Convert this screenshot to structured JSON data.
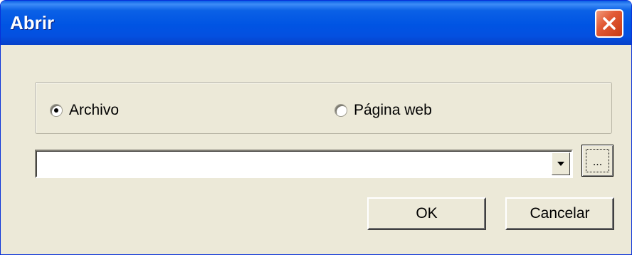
{
  "window": {
    "title": "Abrir",
    "title_bar_color": "#0054e3",
    "close_icon": "close-icon"
  },
  "source_group": {
    "options": [
      {
        "label": "Archivo",
        "checked": true
      },
      {
        "label": "Página web",
        "checked": false
      }
    ]
  },
  "address": {
    "value": "",
    "dropdown_icon": "chevron-down-icon"
  },
  "browse": {
    "label": "..."
  },
  "buttons": {
    "ok_label": "OK",
    "cancel_label": "Cancelar"
  }
}
